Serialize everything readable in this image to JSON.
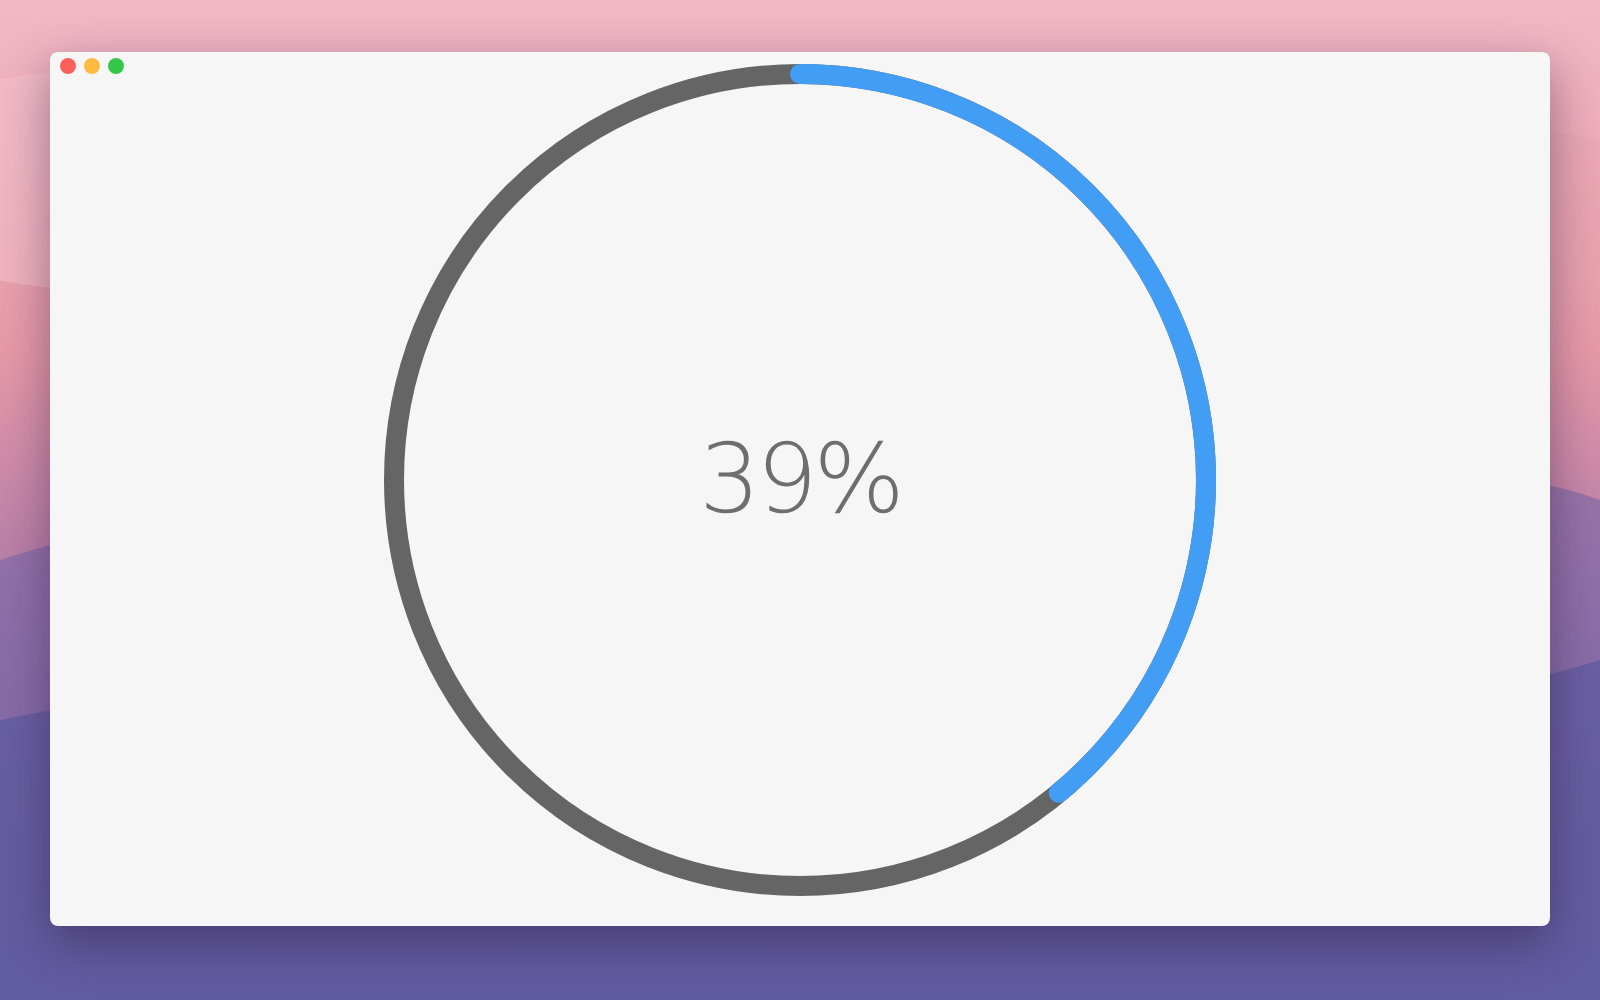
{
  "progress": {
    "label": "39%"
  }
}
